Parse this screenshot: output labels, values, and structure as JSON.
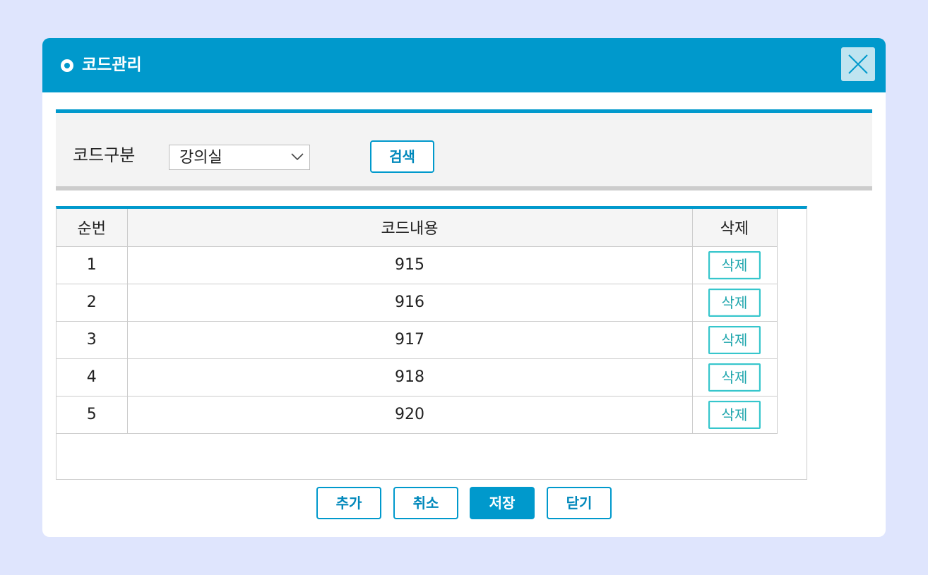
{
  "dialog": {
    "title": "코드관리"
  },
  "search": {
    "label": "코드구분",
    "selected_value": "강의실",
    "search_button": "검색"
  },
  "grid": {
    "headers": [
      "순번",
      "코드내용",
      "삭제"
    ],
    "rows": [
      {
        "seq": "1",
        "content": "915",
        "delete_label": "삭제"
      },
      {
        "seq": "2",
        "content": "916",
        "delete_label": "삭제"
      },
      {
        "seq": "3",
        "content": "917",
        "delete_label": "삭제"
      },
      {
        "seq": "4",
        "content": "918",
        "delete_label": "삭제"
      },
      {
        "seq": "5",
        "content": "920",
        "delete_label": "삭제"
      }
    ]
  },
  "footer": {
    "add": "추가",
    "cancel": "취소",
    "save": "저장",
    "close": "닫기"
  },
  "colors": {
    "accent": "#0099cc",
    "page_background": "#dfe5fd",
    "delete_button_border": "#36c6cc"
  },
  "icons": {
    "title_bullet": "circle-bullet-icon",
    "close": "close-icon",
    "select": "chevron-down-icon"
  }
}
